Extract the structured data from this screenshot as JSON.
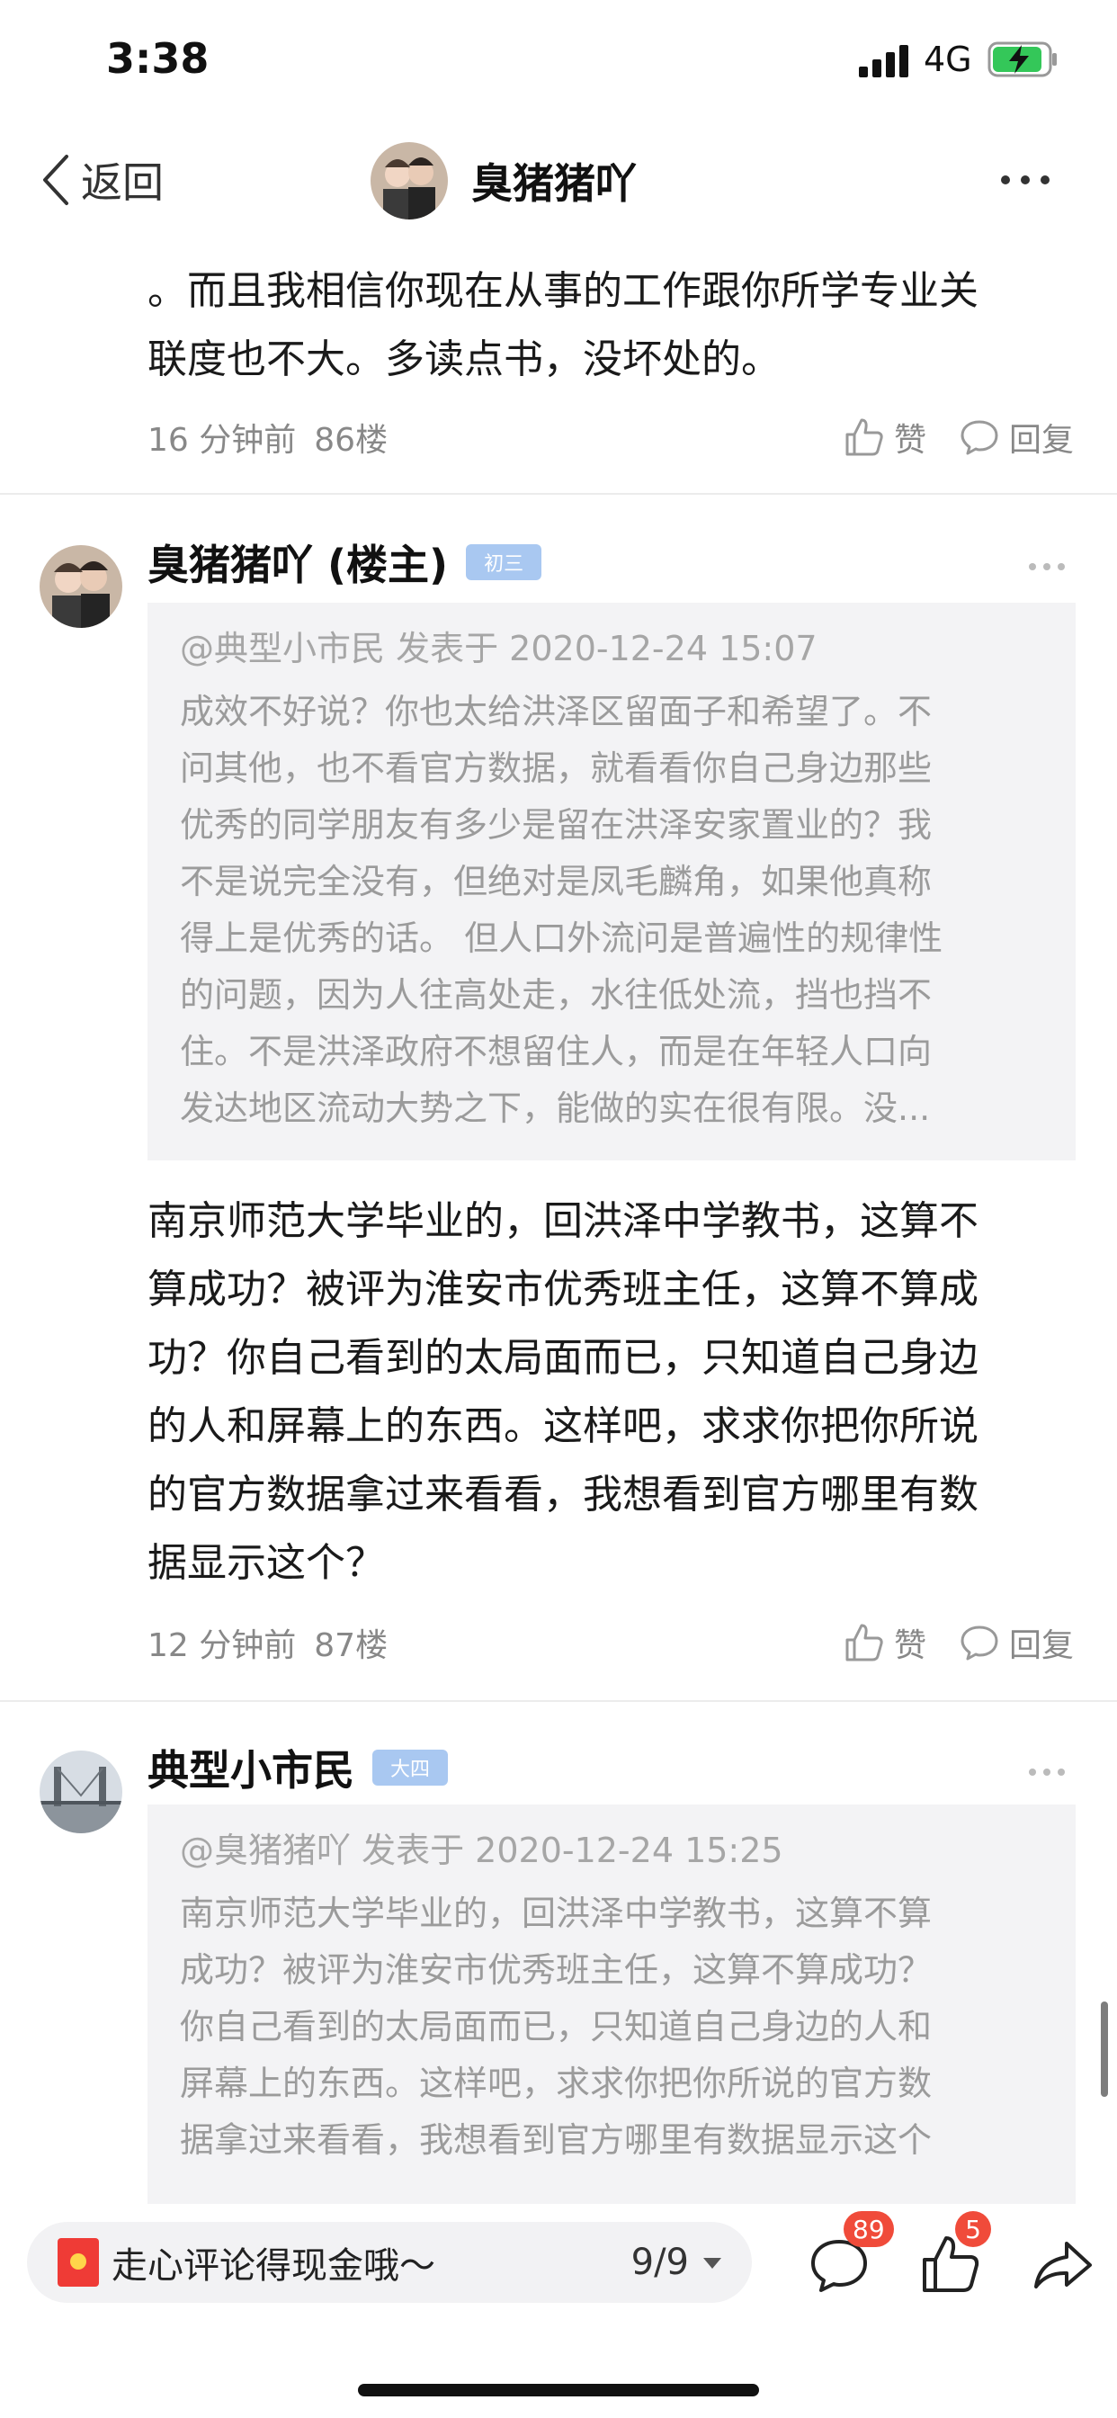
{
  "status": {
    "time": "3:38",
    "network": "4G"
  },
  "nav": {
    "back_label": "返回",
    "title": "臭猪猪吖"
  },
  "prev_post": {
    "lines": [
      "。而且我相信你现在从事的工作跟你所学专业关",
      "联度也不大。多读点书，没坏处的。"
    ],
    "time": "16 分钟前",
    "floor": "86楼"
  },
  "actions": {
    "like": "赞",
    "reply": "回复"
  },
  "comments": [
    {
      "name": "臭猪猪吖 (楼主)",
      "badge": "初三",
      "quote_head": "@典型小市民 发表于 2020-12-24 15:07",
      "quote_lines": [
        "成效不好说？你也太给洪泽区留面子和希望了。不",
        "问其他，也不看官方数据，就看看你自己身边那些",
        "优秀的同学朋友有多少是留在洪泽安家置业的？我",
        "不是说完全没有，但绝对是凤毛麟角，如果他真称",
        "得上是优秀的话。 但人口外流问是普遍性的规律性",
        "的问题，因为人往高处走，水往低处流，挡也挡不",
        "住。不是洪泽政府不想留住人，而是在年轻人口向",
        "发达地区流动大势之下，能做的实在很有限。没..."
      ],
      "body_lines": [
        "南京师范大学毕业的，回洪泽中学教书，这算不",
        "算成功？被评为淮安市优秀班主任，这算不算成",
        "功？你自己看到的太局面而已，只知道自己身边",
        "的人和屏幕上的东西。这样吧，求求你把你所说",
        "的官方数据拿过来看看，我想看到官方哪里有数",
        "据显示这个？"
      ],
      "time": "12 分钟前",
      "floor": "87楼"
    },
    {
      "name": "典型小市民",
      "badge": "大四",
      "quote_head": "@臭猪猪吖 发表于 2020-12-24 15:25",
      "quote_lines": [
        "南京师范大学毕业的，回洪泽中学教书，这算不算",
        "成功？被评为淮安市优秀班主任，这算不算成功？",
        "你自己看到的太局面而已，只知道自己身边的人和",
        "屏幕上的东西。这样吧，求求你把你所说的官方数",
        "据拿过来看看，我想看到官方哪里有数据显示这个"
      ]
    }
  ],
  "bottom": {
    "input_text": "走心评论得现金哦～",
    "page": "9/9",
    "comment_count": "89",
    "like_count": "5"
  },
  "colors": {
    "badge": "#a9c8f1",
    "notification": "#f04b3a",
    "quote_bg": "#f3f3f5"
  }
}
